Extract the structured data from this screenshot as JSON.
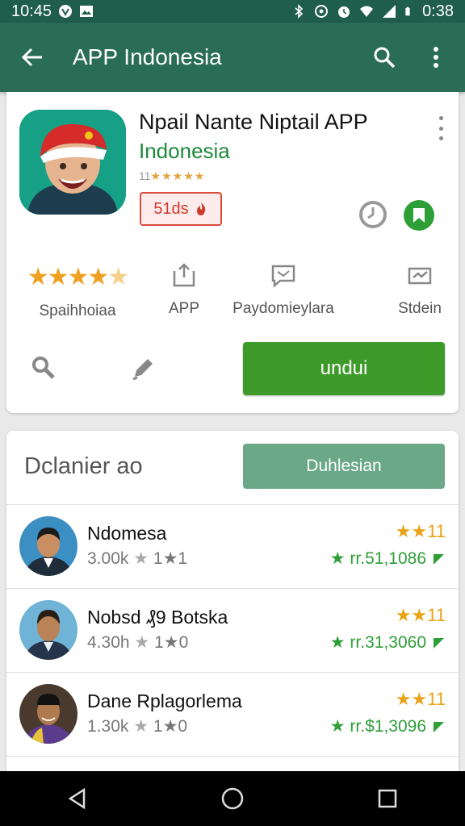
{
  "status_bar": {
    "time": "10:45",
    "battery_time": "0:38"
  },
  "app_bar": {
    "title": "APP Indonesia"
  },
  "app": {
    "name": "Npail Nante Niptail APP",
    "subtitle": "Indonesia",
    "small_rating_prefix": "11",
    "small_rating_stars": "★★★★★",
    "badge": "51ds"
  },
  "stats": [
    {
      "label": "Spaihhoiaa"
    },
    {
      "label": "APP"
    },
    {
      "label": "Paydomieylara"
    },
    {
      "label": "Stdein"
    }
  ],
  "rating_stars": "★★★★",
  "rating_fade_star": "★",
  "install_button": "undui",
  "section": {
    "title": "Dclanier ao",
    "button": "Duhlesian"
  },
  "list": [
    {
      "name": "Ndomesa",
      "meta": "3.00k",
      "meta_star": "★",
      "meta_tail": "1★1",
      "stars": "★★11",
      "price": "★ rr.51,1086"
    },
    {
      "name": "Nobsd ₰9 Botska",
      "meta": "4.30h",
      "meta_star": "★",
      "meta_tail": "1★0",
      "stars": "★★11",
      "price": "★ rr.31,3060"
    },
    {
      "name": "Dane Rplagorlema",
      "meta": "1.30k",
      "meta_star": "★",
      "meta_tail": "1★0",
      "stars": "★★11",
      "price": "★ rr.$1,3096"
    }
  ],
  "colors": {
    "app_bar": "#2a6d57",
    "status_bar": "#1f5e4b",
    "install": "#3e9b2a",
    "secondary_button": "#6aa887",
    "subtitle_green": "#1e8a3b",
    "star_orange": "#f0a020",
    "badge_red": "#d94b3b"
  },
  "icons": {
    "status_left": [
      "v-badge-icon",
      "gallery-icon"
    ],
    "status_right": [
      "bluetooth-icon",
      "data-saver-icon",
      "alarm-icon",
      "wifi-icon",
      "signal-icon",
      "battery-icon"
    ],
    "app_bar": [
      "back-arrow-icon",
      "search-icon",
      "more-vert-icon"
    ],
    "stats": [
      "share-icon",
      "chat-icon",
      "mail-icon"
    ],
    "actions": [
      "search-zoom-icon",
      "edit-pen-icon"
    ],
    "nav": [
      "nav-back-icon",
      "nav-home-icon",
      "nav-recents-icon"
    ]
  }
}
